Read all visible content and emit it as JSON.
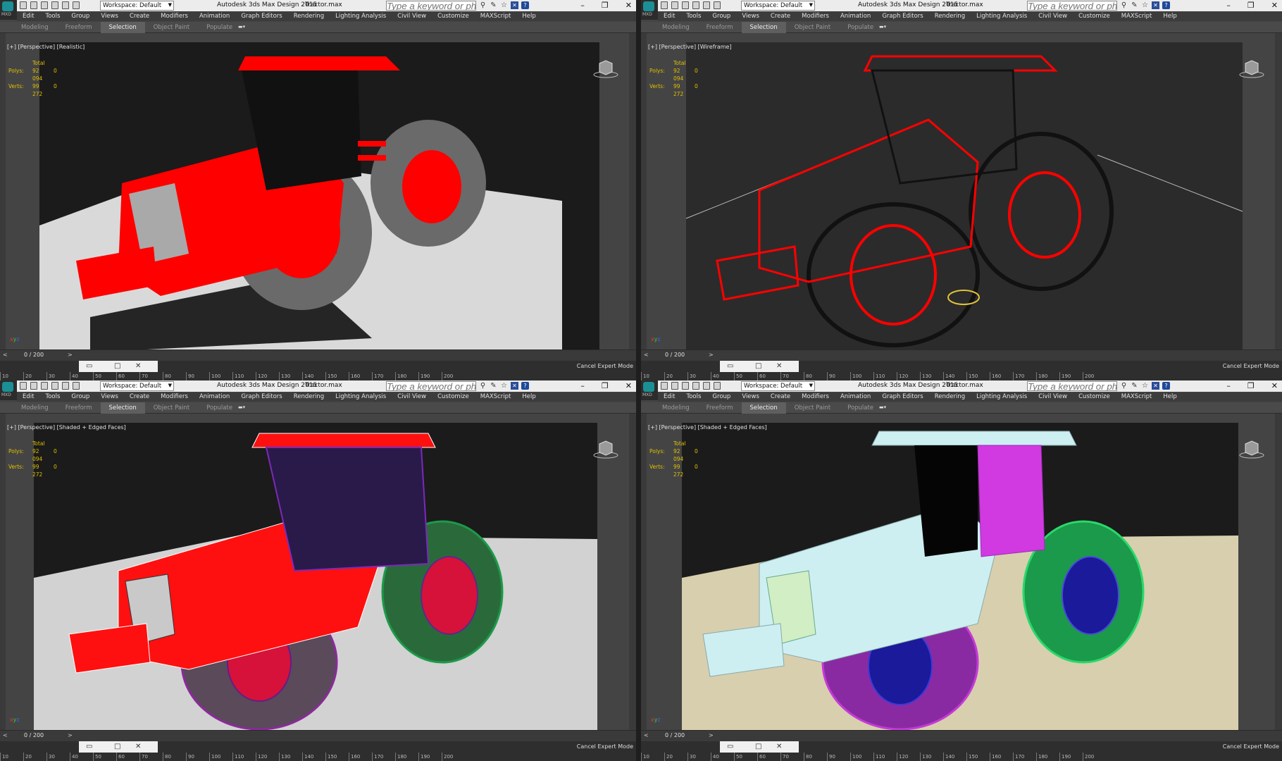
{
  "app": {
    "title": "Autodesk 3ds Max Design 2015",
    "file": "Tractor.max",
    "workspace": "Workspace: Default",
    "search_placeholder": "Type a keyword or phrase",
    "logo_text": "MXD"
  },
  "menu": [
    "Edit",
    "Tools",
    "Group",
    "Views",
    "Create",
    "Modifiers",
    "Animation",
    "Graph Editors",
    "Rendering",
    "Lighting Analysis",
    "Civil View",
    "Customize",
    "MAXScript",
    "Help"
  ],
  "ribbon_tabs": [
    "Modeling",
    "Freeform",
    "Selection",
    "Object Paint",
    "Populate"
  ],
  "active_ribbon_tab": "Selection",
  "stats": {
    "header": "Total",
    "polys_label": "Polys:",
    "polys": "92 094",
    "polys_sel": "0",
    "verts_label": "Verts:",
    "verts": "99 272",
    "verts_sel": "0"
  },
  "timeslider": {
    "label": "0 / 200",
    "left_arrow": "<",
    "right_arrow": ">"
  },
  "ruler_ticks": [
    "10",
    "20",
    "30",
    "40",
    "50",
    "60",
    "70",
    "80",
    "90",
    "100",
    "110",
    "120",
    "130",
    "140",
    "150",
    "160",
    "170",
    "180",
    "190",
    "200"
  ],
  "cancel_expert_mode": "Cancel Expert Mode",
  "viewports": [
    {
      "label": "[+] [Perspective] [Realistic]"
    },
    {
      "label": "[+] [Perspective] [Wireframe]"
    },
    {
      "label": "[+] [Perspective] [Shaded + Edged Faces]"
    },
    {
      "label": "[+] [Perspective] [Shaded + Edged Faces]"
    }
  ],
  "colors": {
    "accent": "#c9a51a",
    "tractor_red": "#ff0000",
    "ground": "#d9d9d9",
    "ground_beige": "#d8cfae",
    "tire_gray": "#6a6a6a"
  }
}
